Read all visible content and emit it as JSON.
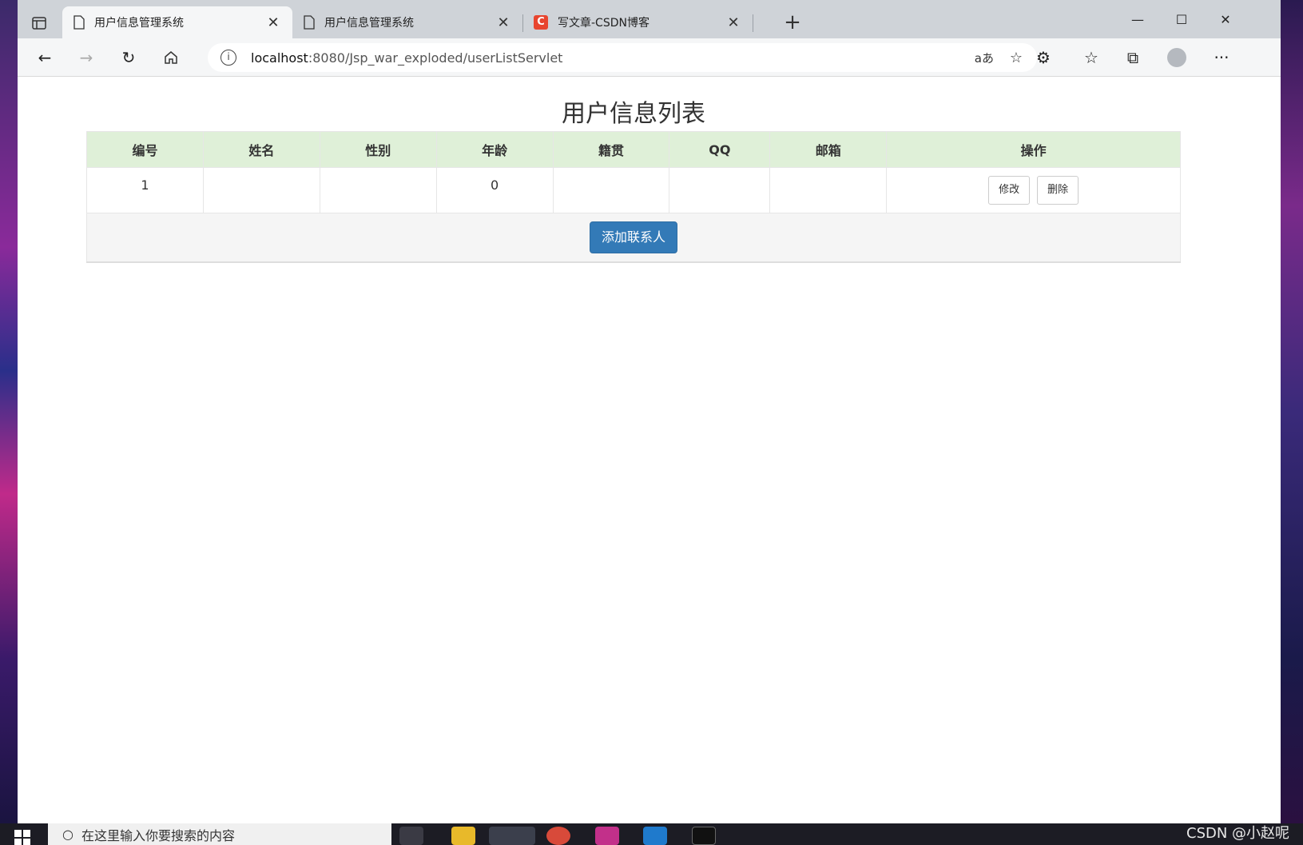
{
  "browser": {
    "tabs": [
      {
        "title": "用户信息管理系统",
        "active": true
      },
      {
        "title": "用户信息管理系统",
        "active": false
      },
      {
        "title": "写文章-CSDN博客",
        "active": false
      }
    ],
    "csdn_logo_letter": "C",
    "address": {
      "host": "localhost",
      "path": ":8080/Jsp_war_exploded/userListServlet"
    },
    "read_aloud": "aあ"
  },
  "page": {
    "title": "用户信息列表",
    "columns": [
      "编号",
      "姓名",
      "性别",
      "年龄",
      "籍贯",
      "QQ",
      "邮箱",
      "操作"
    ],
    "rows": [
      {
        "id": "1",
        "name": "",
        "gender": "",
        "age": "0",
        "hometown": "",
        "qq": "",
        "email": "",
        "edit_label": "修改",
        "delete_label": "删除"
      }
    ],
    "add_button_label": "添加联系人"
  },
  "taskbar": {
    "search_placeholder": "在这里输入你要搜索的内容"
  },
  "watermark": "CSDN @小赵呢",
  "colors": {
    "header_bg": "#dff0d8",
    "primary_button": "#337ab7",
    "csdn_brand": "#e8452f"
  }
}
